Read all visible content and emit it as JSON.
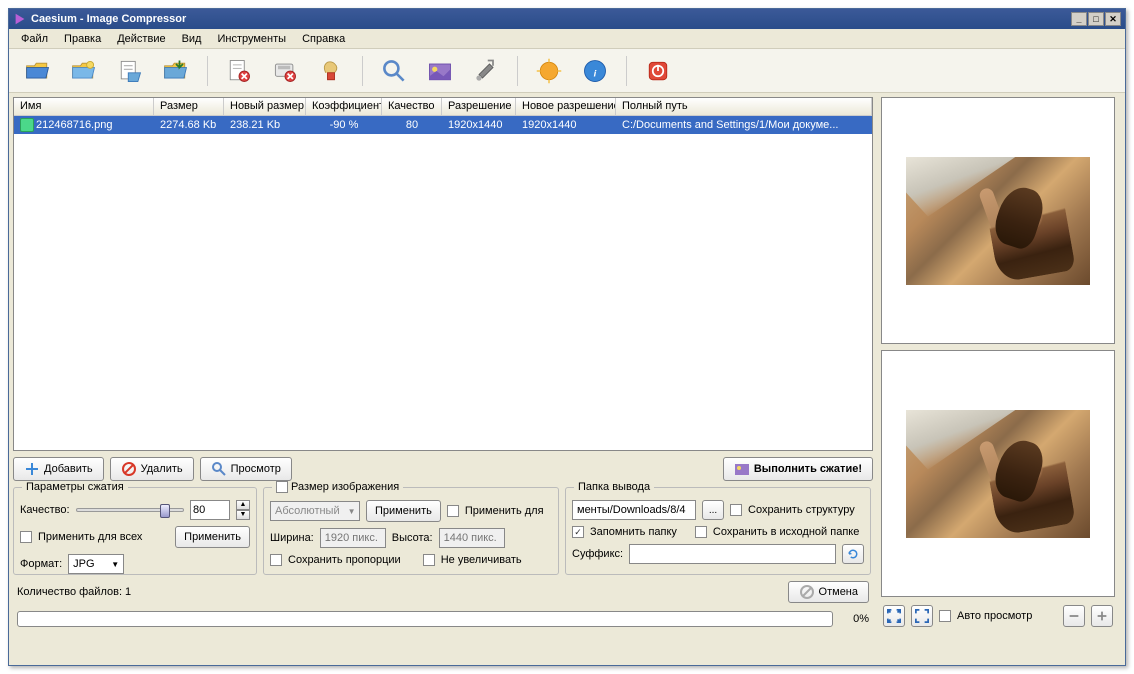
{
  "title": "Caesium - Image Compressor",
  "menu": {
    "file": "Файл",
    "edit": "Правка",
    "action": "Действие",
    "view": "Вид",
    "tools": "Инструменты",
    "help": "Справка"
  },
  "columns": {
    "name": "Имя",
    "size": "Размер",
    "newsize": "Новый размер",
    "coeff": "Коэффициент",
    "quality": "Качество",
    "res": "Разрешение",
    "newres": "Новое разрешение",
    "path": "Полный путь"
  },
  "rows": [
    {
      "name": "212468716.png",
      "size": "2274.68 Kb",
      "newsize": "238.21 Kb",
      "coeff": "-90 %",
      "quality": "80",
      "res": "1920x1440",
      "newres": "1920x1440",
      "path": "C:/Documents and Settings/1/Мои докуме..."
    }
  ],
  "actions": {
    "add": "Добавить",
    "remove": "Удалить",
    "preview": "Просмотр",
    "compress": "Выполнить сжатие!"
  },
  "compression": {
    "title": "Параметры сжатия",
    "quality_label": "Качество:",
    "quality_value": "80",
    "apply_all": "Применить для всех",
    "apply": "Применить",
    "format_label": "Формат:",
    "format_value": "JPG"
  },
  "imagesize": {
    "title": "Размер изображения",
    "mode": "Абсолютный",
    "apply": "Применить",
    "apply_for": "Применить для",
    "width_label": "Ширина:",
    "width_ph": "1920 пикс.",
    "height_label": "Высота:",
    "height_ph": "1440 пикс.",
    "keep_ratio": "Сохранить пропорции",
    "no_enlarge": "Не увеличивать"
  },
  "output": {
    "title": "Папка вывода",
    "path": "менты/Downloads/8/4",
    "browse": "...",
    "keep_struct": "Сохранить структуру",
    "remember": "Запомнить папку",
    "save_orig": "Сохранить в исходной папке",
    "suffix_label": "Суффикс:",
    "suffix_value": ""
  },
  "status": {
    "count_label": "Количество файлов: 1",
    "cancel": "Отмена",
    "progress": "0%"
  },
  "right": {
    "auto_preview": "Авто просмотр"
  }
}
